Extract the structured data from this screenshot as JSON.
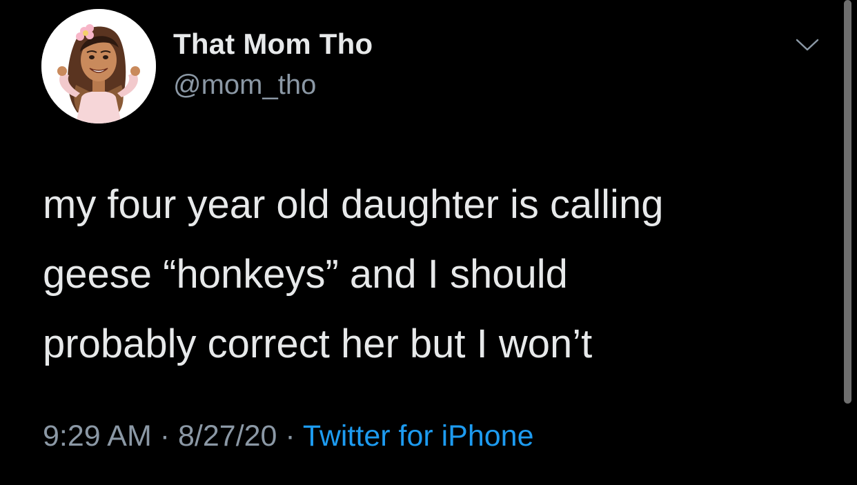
{
  "tweet": {
    "author": {
      "display_name": "That Mom Tho",
      "handle": "@mom_tho",
      "avatar_icon": "avatar-bitmoji-woman-icon"
    },
    "text": "my four year old daughter is calling\ngeese “honkeys” and I should\nprobably correct her but I won’t",
    "time": "9:29 AM",
    "date": "8/27/20",
    "separator": "·",
    "source": "Twitter for iPhone"
  },
  "colors": {
    "background": "#000000",
    "primary_text": "#e7e9ea",
    "secondary_text": "#8b98a5",
    "link": "#1d9bf0",
    "scrollbar": "#6e6e6e"
  },
  "icons": {
    "menu": "chevron-down-icon"
  }
}
